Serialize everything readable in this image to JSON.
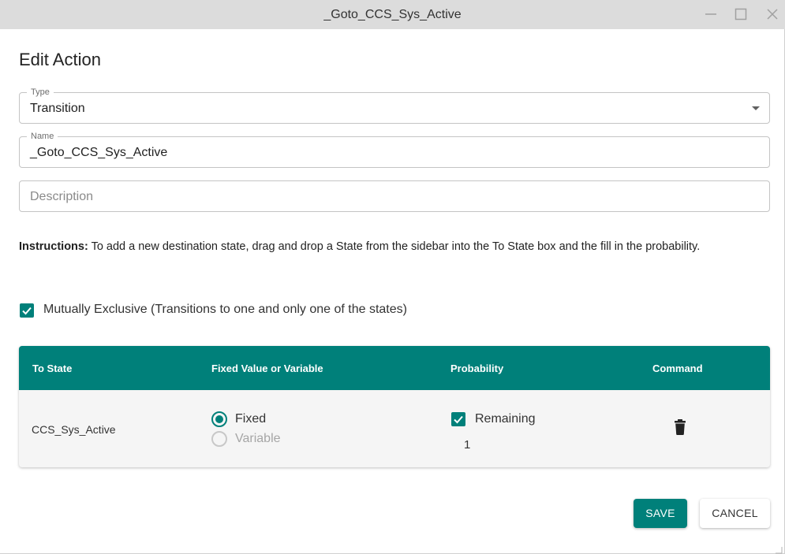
{
  "window": {
    "title": "_Goto_CCS_Sys_Active"
  },
  "dialog": {
    "heading": "Edit Action"
  },
  "type_field": {
    "legend": "Type",
    "value": "Transition"
  },
  "name_field": {
    "legend": "Name",
    "value": "_Goto_CCS_Sys_Active"
  },
  "description_field": {
    "placeholder": "Description",
    "value": ""
  },
  "instructions": {
    "label": "Instructions:",
    "text": " To add a new destination state, drag and drop a State from the sidebar into the To State box and the fill in the probability."
  },
  "mutually_exclusive": {
    "checked": true,
    "label": "Mutually Exclusive (Transitions to one and only one of the states)"
  },
  "table": {
    "headers": {
      "to_state": "To State",
      "fixed_or_variable": "Fixed Value or Variable",
      "probability": "Probability",
      "command": "Command"
    },
    "rows": [
      {
        "to_state": "CCS_Sys_Active",
        "fixed_label": "Fixed",
        "variable_label": "Variable",
        "selected": "Fixed",
        "remaining_label": "Remaining",
        "remaining_checked": true,
        "probability_value": "1"
      }
    ]
  },
  "buttons": {
    "save": "SAVE",
    "cancel": "CANCEL"
  },
  "colors": {
    "accent": "#00807a",
    "titlebar": "#dcdcdc"
  }
}
